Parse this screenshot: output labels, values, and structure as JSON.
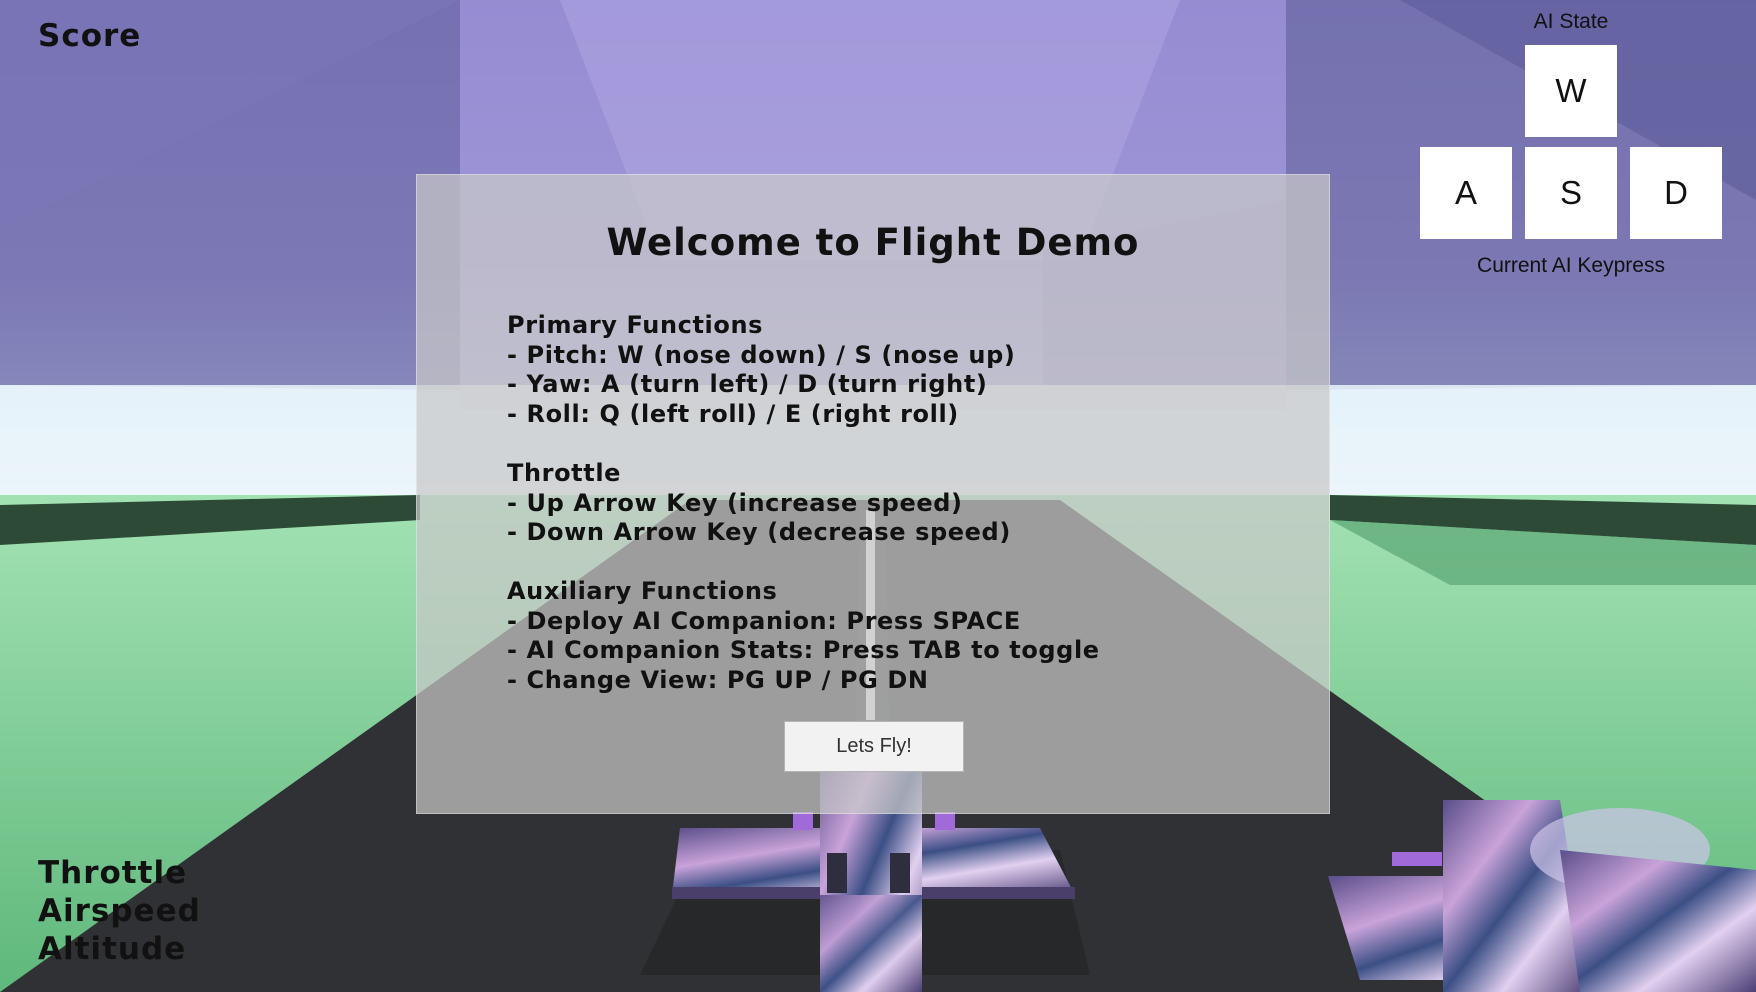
{
  "hud": {
    "score_label": "Score",
    "throttle_label": "Throttle",
    "airspeed_label": "Airspeed",
    "altitude_label": "Altitude"
  },
  "ai_panel": {
    "title": "AI State",
    "keys": {
      "w": "W",
      "a": "A",
      "s": "S",
      "d": "D"
    },
    "caption": "Current AI Keypress"
  },
  "welcome": {
    "title": "Welcome to Flight Demo",
    "sections": [
      {
        "heading": "Primary Functions",
        "lines": [
          "- Pitch: W (nose down) / S (nose up)",
          "- Yaw: A (turn left) / D (turn right)",
          "- Roll: Q (left roll) / E (right roll)"
        ]
      },
      {
        "heading": "Throttle",
        "lines": [
          "- Up Arrow Key (increase speed)",
          "- Down Arrow Key (decrease speed)"
        ]
      },
      {
        "heading": "Auxiliary Functions",
        "lines": [
          "- Deploy AI Companion: Press SPACE",
          "- AI Companion Stats: Press TAB to toggle",
          "- Change View: PG UP / PG DN"
        ]
      }
    ],
    "start_button": "Lets Fly!"
  },
  "colors": {
    "sky_top": "#9a90d0",
    "horizon": "#eef6fb",
    "grass": "#7fd49a",
    "runway": "#2f3134",
    "panel": "#c8c8c8"
  }
}
